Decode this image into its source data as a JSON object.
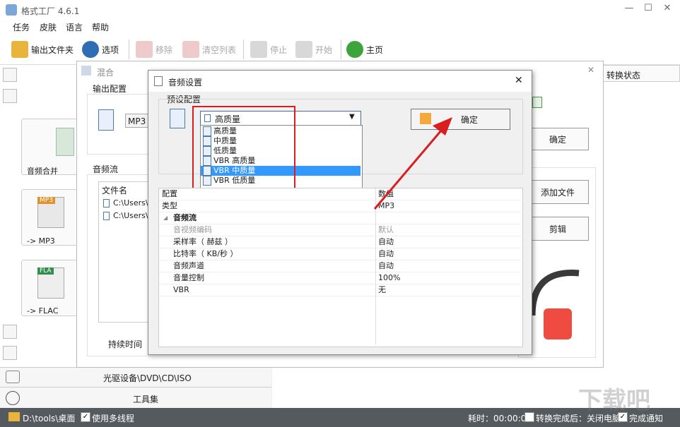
{
  "app": {
    "title": "格式工厂 4.6.1"
  },
  "menu": [
    "任务",
    "皮肤",
    "语言",
    "帮助"
  ],
  "toolbar": {
    "output_folder": "输出文件夹",
    "options": "选项",
    "remove": "移除",
    "clear_list": "清空列表",
    "stop": "停止",
    "start": "开始",
    "home": "主页"
  },
  "left": {
    "tiles": [
      {
        "label": "音频合并"
      },
      {
        "label": "-> MP3",
        "badge": "MP3"
      },
      {
        "label": "-> FLAC",
        "badge": "FLA"
      }
    ],
    "optical": "光驱设备\\DVD\\CD\\ISO",
    "tools": "工具集"
  },
  "right": {
    "status_header": "转换状态",
    "ok": "确定",
    "add_file": "添加文件",
    "clip": "剪辑"
  },
  "mix_dialog": {
    "title": "混合",
    "output_config": "输出配置",
    "format_value": "MP3",
    "audio_stream": "音频流",
    "file_name_header": "文件名",
    "files": [
      "C:\\Users\\p",
      "C:\\Users\\p"
    ],
    "duration": "持续时间"
  },
  "audio_dialog": {
    "title": "音频设置",
    "preset_group": "预设配置",
    "selected": "高质量",
    "options": [
      "高质量",
      "中质量",
      "低质量",
      "VBR 高质量",
      "VBR 中质量",
      "VBR 低质量"
    ],
    "highlighted_index": 4,
    "confirm": "确定",
    "grid": {
      "col1": "配置",
      "col2": "数值",
      "rows": [
        {
          "k": "类型",
          "v": "MP3",
          "kind": "top"
        },
        {
          "k": "音频流",
          "v": "",
          "kind": "section"
        },
        {
          "k": "音视频编码",
          "v": "默认",
          "kind": "disabled"
        },
        {
          "k": "采样率（ 赫兹 ）",
          "v": "自动",
          "kind": "normal"
        },
        {
          "k": "比特率（ KB/秒 ）",
          "v": "自动",
          "kind": "normal"
        },
        {
          "k": "音频声道",
          "v": "自动",
          "kind": "normal"
        },
        {
          "k": "音量控制",
          "v": "100%",
          "kind": "normal"
        },
        {
          "k": "VBR",
          "v": "无",
          "kind": "normal"
        }
      ]
    }
  },
  "status_bar": {
    "path": "D:\\tools\\桌面",
    "multithread": "使用多线程",
    "elapsed": "耗时：00:00:00",
    "after_done": "转换完成后：关闭电脑",
    "notify": "完成通知"
  },
  "watermark": "下载吧",
  "colors": {
    "highlight": "#3399ff",
    "annotation_red": "#d81e1e",
    "statusbar": "#545a5e"
  }
}
